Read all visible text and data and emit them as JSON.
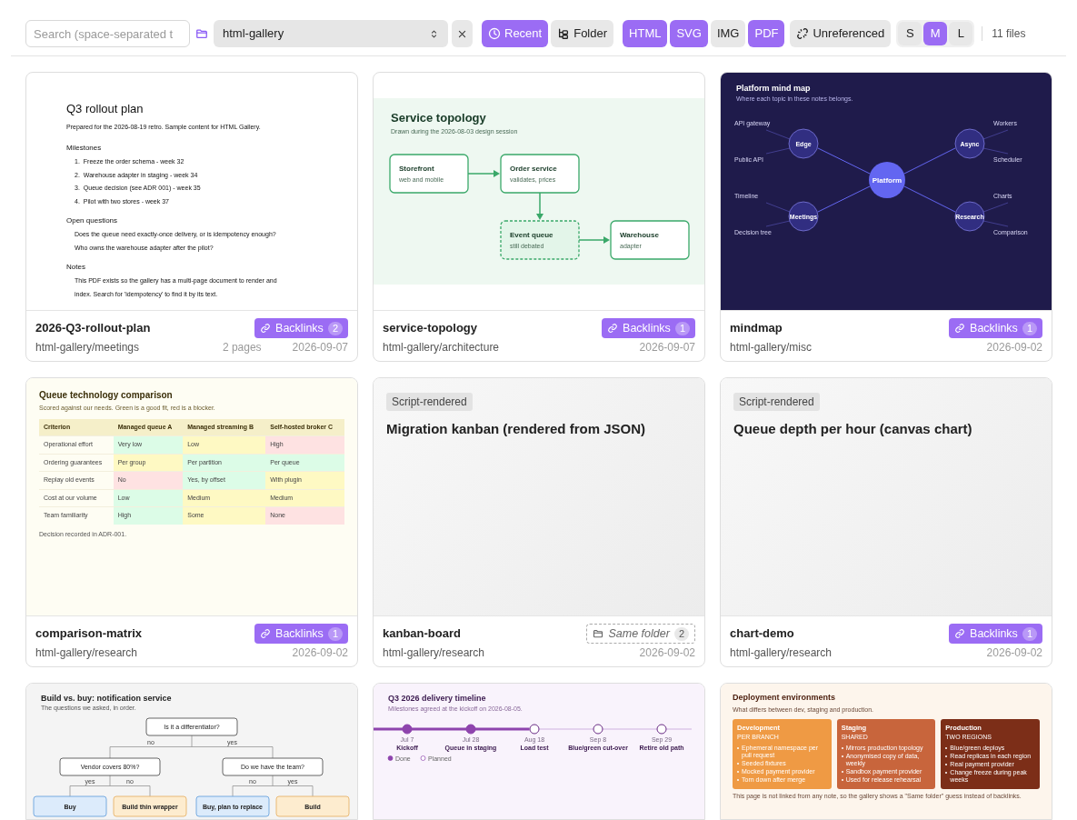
{
  "toolbar": {
    "search": {
      "placeholder": "Search (space-separated t"
    },
    "folder": {
      "value": "html-gallery"
    },
    "sort": [
      {
        "label": "Recent",
        "kind": "clock",
        "selected": true
      },
      {
        "label": "Folder",
        "kind": "tree",
        "selected": false
      }
    ],
    "types": [
      {
        "label": "HTML",
        "selected": true
      },
      {
        "label": "SVG",
        "selected": true
      },
      {
        "label": "IMG",
        "selected": false
      },
      {
        "label": "PDF",
        "selected": true
      }
    ],
    "unreferenced": {
      "label": "Unreferenced",
      "selected": false
    },
    "sizes": [
      {
        "label": "S",
        "selected": false
      },
      {
        "label": "M",
        "selected": true
      },
      {
        "label": "L",
        "selected": false
      }
    ],
    "count": "11 files"
  },
  "cards": [
    {
      "title": "2026-Q3-rollout-plan",
      "path": "html-gallery/meetings",
      "pages": "2 pages",
      "date": "2026-09-07",
      "badge": {
        "kind": "backlinks",
        "label": "Backlinks",
        "count": "2"
      },
      "preview": {
        "kind": "document",
        "title": "Q3 rollout plan",
        "subtitle": "Prepared for the 2026-08-19 retro. Sample content for HTML Gallery.",
        "sections": [
          {
            "heading": "Milestones",
            "items": [
              {
                "number": "1.",
                "text": "Freeze the order schema  -  week 32"
              },
              {
                "number": "2.",
                "text": "Warehouse adapter in staging  -  week 34"
              },
              {
                "number": "3.",
                "text": "Queue decision (see ADR 001)  -  week 35"
              },
              {
                "number": "4.",
                "text": "Pilot with two stores  -  week 37"
              }
            ]
          },
          {
            "heading": "Open questions",
            "items": [
              {
                "text": "Does the queue need exactly-once delivery, or is idempotency enough?"
              },
              {
                "text": "Who owns the warehouse adapter after the pilot?"
              }
            ]
          },
          {
            "heading": "Notes",
            "items": [
              {
                "text": "This PDF exists so the gallery has a multi-page document to render and"
              },
              {
                "text": "index. Search for 'idempotency' to find it by its text."
              }
            ]
          }
        ]
      }
    },
    {
      "title": "service-topology",
      "path": "html-gallery/architecture",
      "date": "2026-09-07",
      "badge": {
        "kind": "backlinks",
        "label": "Backlinks",
        "count": "1"
      },
      "preview": {
        "kind": "topology",
        "title": "Service topology",
        "subtitle": "Drawn during the 2026-08-03 design session",
        "nodes": [
          {
            "name": "Storefront",
            "note": "web and mobile",
            "dashed": false
          },
          {
            "name": "Order service",
            "note": "validates, prices",
            "dashed": false
          },
          {
            "name": "Event queue",
            "note": "still debated",
            "dashed": true
          },
          {
            "name": "Warehouse",
            "note": "adapter",
            "dashed": false
          }
        ]
      }
    },
    {
      "title": "mindmap",
      "path": "html-gallery/misc",
      "date": "2026-09-02",
      "badge": {
        "kind": "backlinks",
        "label": "Backlinks",
        "count": "1"
      },
      "preview": {
        "kind": "mindmap",
        "title": "Platform mind map",
        "subtitle": "Where each topic in these notes belongs.",
        "center": "Platform",
        "branches": [
          {
            "label": "Edge",
            "leaves": [
              "API gateway",
              "Public API"
            ]
          },
          {
            "label": "Async",
            "leaves": [
              "Workers",
              "Scheduler"
            ]
          },
          {
            "label": "Meetings",
            "leaves": [
              "Timeline",
              "Decision tree"
            ]
          },
          {
            "label": "Research",
            "leaves": [
              "Charts",
              "Comparison"
            ]
          }
        ]
      }
    },
    {
      "title": "comparison-matrix",
      "path": "html-gallery/research",
      "date": "2026-09-02",
      "badge": {
        "kind": "backlinks",
        "label": "Backlinks",
        "count": "1"
      },
      "preview": {
        "kind": "matrix",
        "title": "Queue technology comparison",
        "subtitle": "Scored against our needs. Green is a good fit, red is a blocker.",
        "columns": [
          "Criterion",
          "Managed queue A",
          "Managed streaming B",
          "Self-hosted broker C"
        ],
        "rows": [
          {
            "cells": [
              {
                "text": "Operational effort"
              },
              {
                "text": "Very low",
                "color": "#dcfce7"
              },
              {
                "text": "Low",
                "color": "#fef9c3"
              },
              {
                "text": "High",
                "color": "#fee2e2"
              }
            ]
          },
          {
            "cells": [
              {
                "text": "Ordering guarantees"
              },
              {
                "text": "Per group",
                "color": "#fef9c3"
              },
              {
                "text": "Per partition",
                "color": "#dcfce7"
              },
              {
                "text": "Per queue",
                "color": "#dcfce7"
              }
            ]
          },
          {
            "cells": [
              {
                "text": "Replay old events"
              },
              {
                "text": "No",
                "color": "#fee2e2"
              },
              {
                "text": "Yes, by offset",
                "color": "#dcfce7"
              },
              {
                "text": "With plugin",
                "color": "#fef9c3"
              }
            ]
          },
          {
            "cells": [
              {
                "text": "Cost at our volume"
              },
              {
                "text": "Low",
                "color": "#dcfce7"
              },
              {
                "text": "Medium",
                "color": "#fef9c3"
              },
              {
                "text": "Medium",
                "color": "#fef9c3"
              }
            ]
          },
          {
            "cells": [
              {
                "text": "Team familiarity"
              },
              {
                "text": "High",
                "color": "#dcfce7"
              },
              {
                "text": "Some",
                "color": "#fef9c3"
              },
              {
                "text": "None",
                "color": "#fee2e2"
              }
            ]
          }
        ],
        "note": "Decision recorded in ADR-001."
      }
    },
    {
      "title": "kanban-board",
      "path": "html-gallery/research",
      "date": "2026-09-02",
      "badge": {
        "kind": "same_folder",
        "label": "Same folder",
        "count": "2"
      },
      "preview": {
        "kind": "script",
        "tag": "Script-rendered",
        "title": "Migration kanban (rendered from JSON)"
      }
    },
    {
      "title": "chart-demo",
      "path": "html-gallery/research",
      "date": "2026-09-02",
      "badge": {
        "kind": "backlinks",
        "label": "Backlinks",
        "count": "1"
      },
      "preview": {
        "kind": "script",
        "tag": "Script-rendered",
        "title": "Queue depth per hour (canvas chart)"
      }
    },
    {
      "preview": {
        "kind": "decision",
        "title": "Build vs. buy: notification service",
        "subtitle": "The questions we asked, in order.",
        "root": {
          "label": "Is it a differentiator?",
          "branches": [
            {
              "edge": "no",
              "label": "Vendor covers 80%?",
              "branches": [
                {
                  "edge": "yes",
                  "label": "Buy",
                  "kind": "buy"
                },
                {
                  "edge": "no",
                  "label": "Build thin wrapper",
                  "kind": "build"
                }
              ]
            },
            {
              "edge": "yes",
              "label": "Do we have the team?",
              "branches": [
                {
                  "edge": "no",
                  "label": "Buy, plan to replace",
                  "kind": "buy"
                },
                {
                  "edge": "yes",
                  "label": "Build",
                  "kind": "build"
                }
              ]
            }
          ]
        }
      }
    },
    {
      "preview": {
        "kind": "timeline",
        "title": "Q3 2026 delivery timeline",
        "subtitle": "Milestones agreed at the kickoff on 2026-08-05.",
        "milestones": [
          {
            "date": "Jul 7",
            "label": "Kickoff",
            "done": true
          },
          {
            "date": "Jul 28",
            "label": "Queue in staging",
            "done": true
          },
          {
            "date": "Aug 18",
            "label": "Load test",
            "done": false
          },
          {
            "date": "Sep 8",
            "label": "Blue/green cut-over",
            "done": false
          },
          {
            "date": "Sep 29",
            "label": "Retire old path",
            "done": false
          }
        ],
        "level": 0.49,
        "legend": [
          {
            "label": "Done",
            "kind": "done"
          },
          {
            "label": "Planned",
            "kind": "planned"
          }
        ]
      }
    },
    {
      "preview": {
        "kind": "environments",
        "title": "Deployment environments",
        "subtitle": "What differs between dev, staging and production.",
        "columns": [
          {
            "name": "Development",
            "tag": "PER BRANCH",
            "color": "#ef9a44",
            "items": [
              "Ephemeral namespace per pull request",
              "Seeded fixtures",
              "Mocked payment provider",
              "Torn down after merge"
            ]
          },
          {
            "name": "Staging",
            "tag": "SHARED",
            "color": "#c8653c",
            "items": [
              "Mirrors production topology",
              "Anonymised copy of data, weekly",
              "Sandbox payment provider",
              "Used for release rehearsal"
            ]
          },
          {
            "name": "Production",
            "tag": "TWO REGIONS",
            "color": "#7c2e18",
            "items": [
              "Blue/green deploys",
              "Read replicas in each region",
              "Real payment provider",
              "Change freeze during peak weeks"
            ]
          }
        ],
        "note": "This page is not linked from any note, so the gallery shows a \"Same folder\" guess instead of backlinks."
      }
    }
  ]
}
